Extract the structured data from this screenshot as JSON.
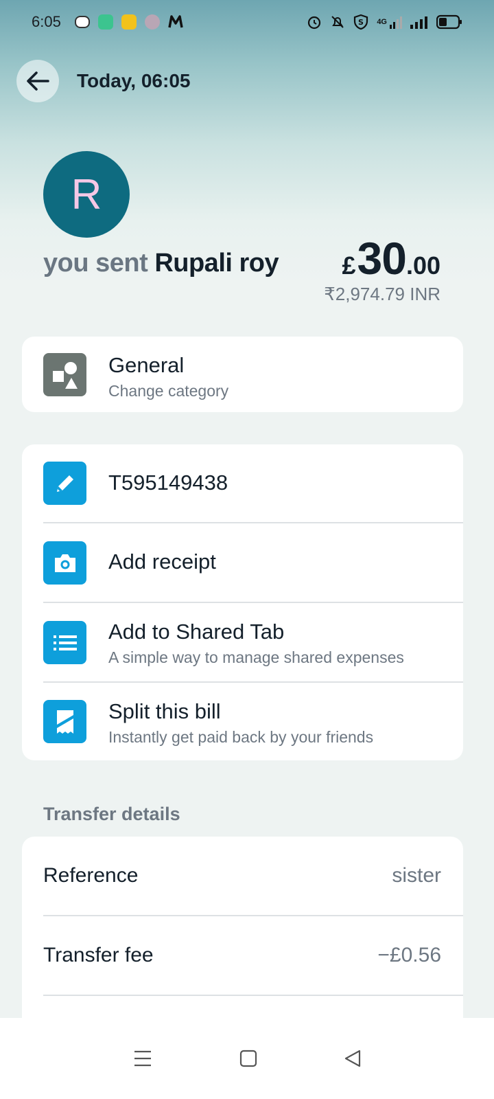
{
  "status_bar": {
    "time": "6:05",
    "network": "4G"
  },
  "header": {
    "title": "Today, 06:05"
  },
  "recipient": {
    "avatar_letter": "R",
    "sent_prefix": "you sent",
    "name": "Rupali roy"
  },
  "amount": {
    "currency_symbol": "£",
    "whole": "30",
    "decimal": ".00",
    "converted": "₹2,974.79 INR"
  },
  "category": {
    "title": "General",
    "subtitle": "Change category",
    "icon": "shapes-icon"
  },
  "actions": [
    {
      "title": "T595149438",
      "subtitle": "",
      "icon": "pencil-icon"
    },
    {
      "title": "Add receipt",
      "subtitle": "",
      "icon": "camera-icon"
    },
    {
      "title": "Add to Shared Tab",
      "subtitle": "A simple way to manage shared expenses",
      "icon": "list-icon"
    },
    {
      "title": "Split this bill",
      "subtitle": "Instantly get paid back by your friends",
      "icon": "receipt-split-icon"
    }
  ],
  "transfer_details": {
    "section_title": "Transfer details",
    "rows": [
      {
        "label": "Reference",
        "value": "sister"
      },
      {
        "label": "Transfer fee",
        "value": "−£0.56"
      }
    ]
  },
  "colors": {
    "accent_blue": "#0e9fdb",
    "avatar_bg": "#0e6b80",
    "avatar_letter": "#f5c8e6",
    "category_icon_bg": "#6b7571"
  }
}
